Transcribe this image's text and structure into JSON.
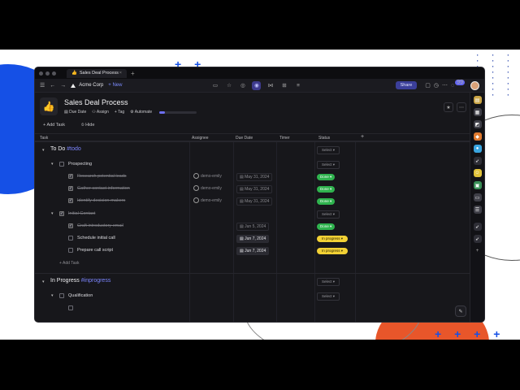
{
  "tab": {
    "title": "Sales Deal Process",
    "emoji": "👍"
  },
  "toolbar": {
    "org": "Acme Corp",
    "new_label": "+ New",
    "share_label": "Share",
    "badge": "99"
  },
  "page": {
    "emoji": "👍",
    "title": "Sales Deal Process",
    "actions": [
      "Due Date",
      "Assign",
      "Tag",
      "Automate"
    ],
    "progress_fraction": 0.15
  },
  "actions_row": {
    "add_task": "Add Task",
    "hide": "Hide"
  },
  "columns": [
    "Task",
    "Assignee",
    "Due Date",
    "Timer",
    "Status",
    "+"
  ],
  "groups": [
    {
      "title": "To Do",
      "tag": "#todo",
      "select": "Select"
    },
    {
      "title": "In Progress",
      "tag": "#inprogress",
      "select": "Select"
    }
  ],
  "rows": [
    {
      "name": "Prospecting",
      "select": "Select"
    },
    {
      "name": "Research potential leads",
      "assignee": "demo-emily",
      "date": "May 31, 2024",
      "status": "Done"
    },
    {
      "name": "Gather contact information",
      "assignee": "demo-emily",
      "date": "May 31, 2024",
      "status": "Done"
    },
    {
      "name": "Identify decision-makers",
      "assignee": "demo-emily",
      "date": "May 31, 2024",
      "status": "Done"
    },
    {
      "name": "Initial Contact",
      "select": "Select"
    },
    {
      "name": "Craft introductory email",
      "date": "Jun 5, 2024",
      "status": "Done"
    },
    {
      "name": "Schedule initial call",
      "date": "Jun 7, 2024",
      "status": "In progress"
    },
    {
      "name": "Prepare call script",
      "date": "Jun 7, 2024",
      "status": "In progress"
    },
    {
      "name": "Add Task"
    },
    {
      "name": "Qualification",
      "select": "Select"
    }
  ]
}
